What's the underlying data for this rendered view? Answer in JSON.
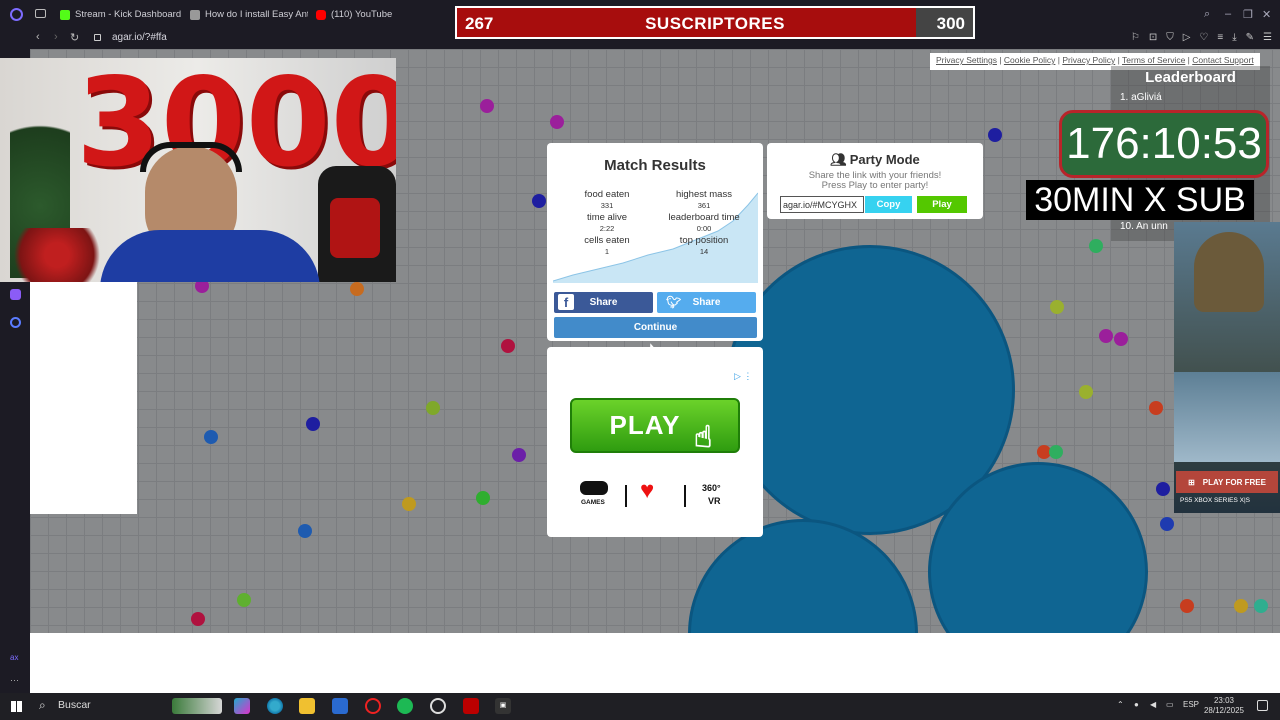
{
  "browser": {
    "tabs": [
      {
        "label": "Stream - Kick Dashboard",
        "color": "#53fc18"
      },
      {
        "label": "How do I install Easy Anti-",
        "color": "#999999"
      },
      {
        "label": "(110) YouTube",
        "color": "#ff0000"
      }
    ],
    "url": "agar.io/?#ffa"
  },
  "overlay": {
    "subs_current": "267",
    "subs_label": "SUSCRIPTORES",
    "subs_goal": "300",
    "subs_progress": 0.89,
    "timer": "176:10:53",
    "promo": "30MIN X SUB",
    "webcam_balloons": "3000"
  },
  "footer_links": [
    "Privacy Settings",
    "Cookie Policy",
    "Privacy Policy",
    "Terms of Service",
    "Contact Support"
  ],
  "leaderboard": {
    "title": "Leaderboard",
    "rows": [
      "1. aGliviá",
      "10. An unn"
    ]
  },
  "match_results": {
    "title": "Match Results",
    "stats": [
      {
        "label": "food eaten",
        "value": "331"
      },
      {
        "label": "highest mass",
        "value": "361"
      },
      {
        "label": "time alive",
        "value": "2:22"
      },
      {
        "label": "leaderboard time",
        "value": "0:00"
      },
      {
        "label": "cells eaten",
        "value": "1"
      },
      {
        "label": "top position",
        "value": "14"
      }
    ],
    "facebook_share": "Share",
    "twitter_share": "Share",
    "continue": "Continue"
  },
  "party_mode": {
    "title": "Party Mode",
    "desc_line1": "Share the link with your friends!",
    "desc_line2": "Press Play to enter party!",
    "link": "agar.io/#MCYGHX",
    "copy": "Copy",
    "play": "Play"
  },
  "ad": {
    "play": "PLAY",
    "games": "GAMES",
    "vr": "360°",
    "vr_sub": "VR"
  },
  "right_ad": {
    "button": "PLAY FOR FREE",
    "brands": "PS5  XBOX SERIES X|S"
  },
  "taskbar": {
    "search": "Buscar",
    "lang": "ESP",
    "time": "23:03",
    "date": "28/12/2025"
  }
}
